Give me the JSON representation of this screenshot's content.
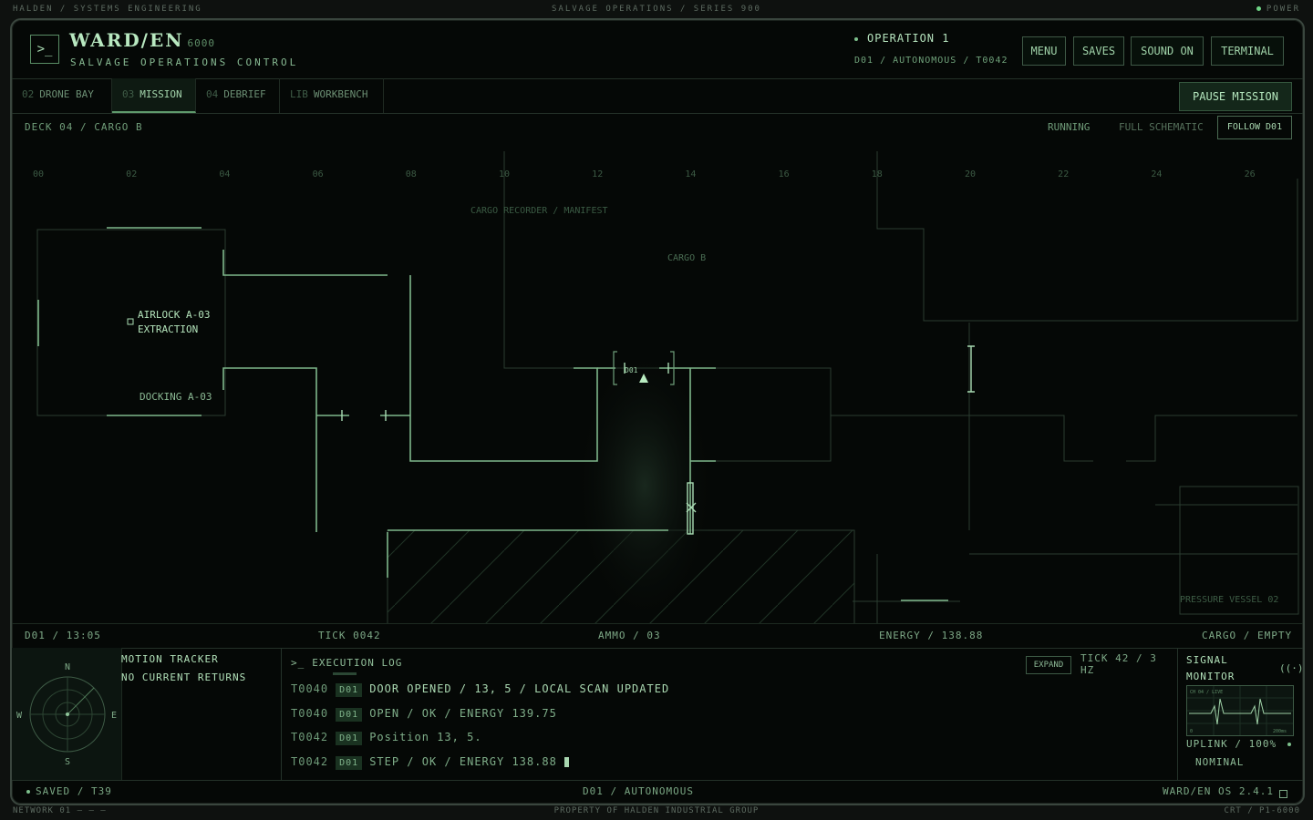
{
  "topbar": {
    "left": "HALDEN / SYSTEMS ENGINEERING",
    "center": "SALVAGE OPERATIONS / SERIES 900",
    "right": "POWER"
  },
  "header": {
    "logo_glyph": ">_",
    "brand": "WARD/EN",
    "brand_num": "6000",
    "subtitle": "SALVAGE OPERATIONS CONTROL",
    "operation": "OPERATION 1",
    "operation_sub": "D01 / AUTONOMOUS / T0042",
    "buttons": [
      "MENU",
      "SAVES",
      "SOUND ON",
      "TERMINAL"
    ]
  },
  "tabs": [
    {
      "num": "02",
      "label": "DRONE BAY",
      "active": false
    },
    {
      "num": "03",
      "label": "MISSION",
      "active": true
    },
    {
      "num": "04",
      "label": "DEBRIEF",
      "active": false
    },
    {
      "num": "LIB",
      "label": "WORKBENCH",
      "active": false
    }
  ],
  "pause_label": "PAUSE MISSION",
  "map": {
    "deck": "DECK 04 / CARGO B",
    "state": "RUNNING",
    "view": "FULL SCHEMATIC",
    "follow": "FOLLOW D01",
    "ruler": [
      "00",
      "02",
      "04",
      "06",
      "08",
      "10",
      "12",
      "14",
      "16",
      "18",
      "20",
      "22",
      "24",
      "26"
    ],
    "labels": {
      "recorder": "CARGO RECORDER / MANIFEST",
      "cargo": "CARGO B",
      "airlock1": "AIRLOCK A-03",
      "airlock2": "EXTRACTION",
      "docking": "DOCKING A-03",
      "vessel": "PRESSURE VESSEL 02",
      "drone": "D01"
    }
  },
  "status": {
    "clock": "D01 / 13:05",
    "tick": "TICK 0042",
    "ammo": "AMMO / 03",
    "energy": "ENERGY / 138.88",
    "cargo": "CARGO / EMPTY"
  },
  "radar": {
    "n": "N",
    "s": "S",
    "e": "E",
    "w": "W"
  },
  "motion": {
    "title": "MOTION TRACKER",
    "status": "NO CURRENT RETURNS"
  },
  "log": {
    "prompt": ">_",
    "title": "EXECUTION LOG",
    "expand": "EXPAND",
    "tick": "TICK 42 / 3 HZ",
    "entries": [
      {
        "t": "T0040",
        "d": "D01",
        "msg": "DOOR OPENED / 13, 5 / LOCAL SCAN UPDATED"
      },
      {
        "t": "T0040",
        "d": "D01",
        "msg": "OPEN / OK / ENERGY 139.75"
      },
      {
        "t": "T0042",
        "d": "D01",
        "msg": "Position 13, 5."
      },
      {
        "t": "T0042",
        "d": "D01",
        "msg": "STEP / OK / ENERGY 138.88"
      }
    ]
  },
  "signal": {
    "title1": "SIGNAL",
    "title2": "MONITOR",
    "uplink": "UPLINK / 100%",
    "nominal": "NOMINAL",
    "scope_tag": "CH 04 / LIVE",
    "scope_min": "0",
    "scope_max": "200ms"
  },
  "footer": {
    "saved": "SAVED / T39",
    "mode": "D01 / AUTONOMOUS",
    "os": "WARD/EN OS 2.4.1"
  },
  "bottombar": {
    "left": "NETWORK 01",
    "center": "PROPERTY OF HALDEN INDUSTRIAL GROUP",
    "right": "CRT / P1-6000"
  }
}
